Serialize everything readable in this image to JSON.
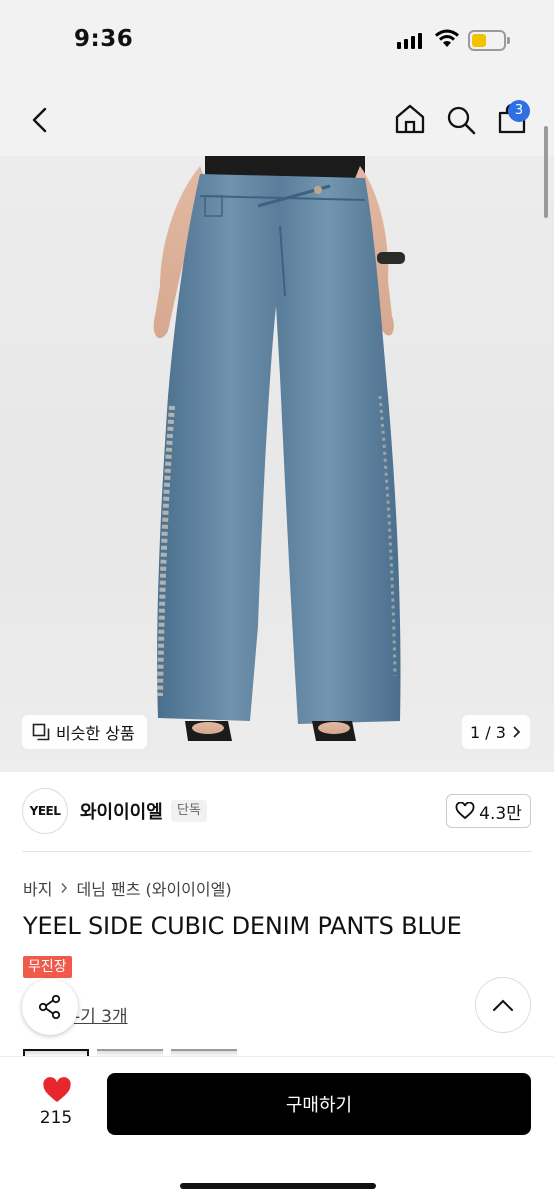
{
  "status_bar": {
    "time": "9:36"
  },
  "header": {
    "cart_count": "3"
  },
  "gallery": {
    "similar_label": "비슷한 상품",
    "counter": "1 / 3"
  },
  "brand": {
    "logo_text": "YEEL",
    "name": "와이이이엘",
    "tag": "단독",
    "likes": "4.3만"
  },
  "product": {
    "breadcrumb": [
      "바지",
      "데님 팬츠 (와이이이엘)"
    ],
    "title": "YEEL SIDE CUBIC DENIM PANTS BLUE",
    "badge": "무진장",
    "review_link": "-기 3개"
  },
  "bottom": {
    "heart_count": "215",
    "buy_label": "구매하기"
  },
  "colors": {
    "accent_blue": "#2f6fe4",
    "heart_red": "#e8262d",
    "badge_red": "#ef5a4a",
    "denim": "#5b7f9c"
  }
}
